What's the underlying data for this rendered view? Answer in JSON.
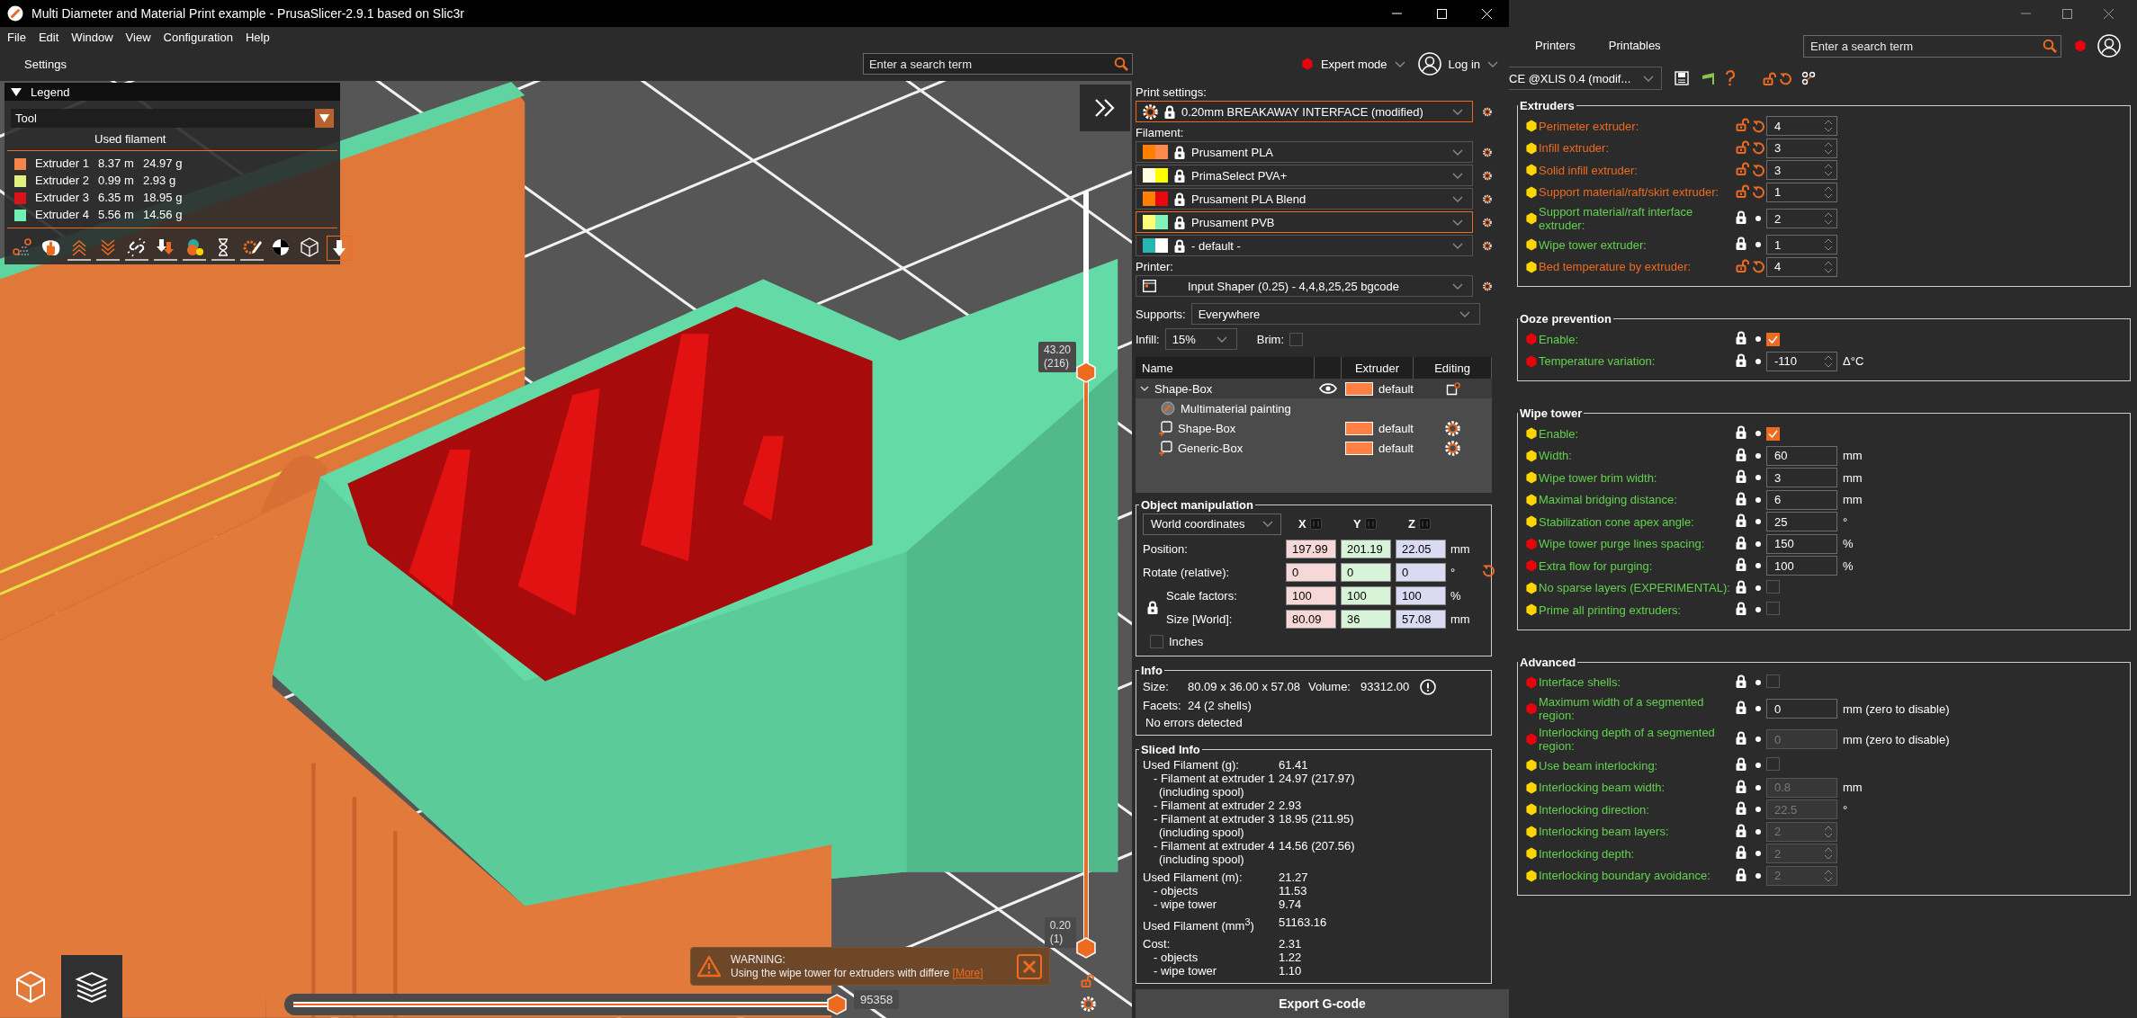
{
  "window": {
    "title": "Multi Diameter and Material Print example - PrusaSlicer-2.9.1 based on Slic3r"
  },
  "menu": [
    "File",
    "Edit",
    "Window",
    "View",
    "Configuration",
    "Help"
  ],
  "toolbar": {
    "settings": "Settings",
    "search": {
      "placeholder": "Enter a search term"
    },
    "mode": "Expert mode",
    "login": "Log in"
  },
  "legend": {
    "title": "Legend",
    "expanded": true,
    "view_type": "Tool",
    "header": "Used filament",
    "items": [
      {
        "name": "Extruder 1",
        "length": "8.37 m",
        "weight": "24.97 g",
        "color": "#f5854a"
      },
      {
        "name": "Extruder 2",
        "length": "0.99 m",
        "weight": "2.93 g",
        "color": "#e4f07e"
      },
      {
        "name": "Extruder 3",
        "length": "6.35 m",
        "weight": "18.95 g",
        "color": "#d8131c"
      },
      {
        "name": "Extruder 4",
        "length": "5.56 m",
        "weight": "14.56 g",
        "color": "#6ff0b4"
      }
    ],
    "options": [
      {
        "kind": "travel",
        "on": false
      },
      {
        "kind": "wipe",
        "on": false
      },
      {
        "kind": "retract",
        "on": true
      },
      {
        "kind": "deretract",
        "on": true
      },
      {
        "kind": "seams",
        "on": true
      },
      {
        "kind": "toolchange",
        "on": true
      },
      {
        "kind": "color_change",
        "on": true
      },
      {
        "kind": "pause",
        "on": true
      },
      {
        "kind": "custom_gcode",
        "on": true
      },
      {
        "kind": "center_of_gravity",
        "on": false
      },
      {
        "kind": "shells",
        "on": false
      },
      {
        "kind": "tool_marker",
        "on": true
      }
    ]
  },
  "viewport": {
    "vertical_slider": {
      "upper_thumb": {
        "value": "43.20",
        "layer": "(216)",
        "level": 0.76
      },
      "lower_thumb": {
        "value": "0.20",
        "layer": "(1)",
        "level": 0
      }
    },
    "horizontal_slider": {
      "value": "95358",
      "level": 1
    },
    "warning": {
      "title": "WARNING:",
      "text": "Using the wipe tower for extruders with differe",
      "link": "[More]"
    },
    "view_modes": [
      {
        "kind": "model",
        "selected": false
      },
      {
        "kind": "preview",
        "selected": true
      }
    ]
  },
  "sidebar": {
    "print_settings": {
      "label": "Print settings:",
      "preset": "0.20mm BREAKAWAY INTERFACE (modified)",
      "highlighted": true
    },
    "filament": {
      "label": "Filament:",
      "items": [
        {
          "name": "Prusament PLA",
          "swatches": [
            {
              "color": "#ff8000"
            },
            {
              "color": "#ff8a4c"
            }
          ],
          "highlighted": false
        },
        {
          "name": "PrimaSelect PVA+",
          "swatches": [
            {
              "color": "#fffde2"
            },
            {
              "color": "#ffff00"
            }
          ],
          "highlighted": false
        },
        {
          "name": "Prusament PLA Blend",
          "swatches": [
            {
              "color": "#ff8000"
            },
            {
              "color": "#e8070c"
            }
          ],
          "highlighted": false
        },
        {
          "name": "Prusament PVB",
          "swatches": [
            {
              "color": "#fcfc76"
            },
            {
              "color": "#82f2b6"
            }
          ],
          "highlighted": true
        },
        {
          "name": "- default -",
          "swatches": [
            {
              "color": "#26b5b0"
            },
            {
              "color": "#ffffff"
            }
          ],
          "highlighted": false
        }
      ]
    },
    "printer": {
      "label": "Printer:",
      "preset": "Input Shaper (0.25) - 4,4,8,25,25 bgcode"
    },
    "supports": {
      "label": "Supports:",
      "value": "Everywhere"
    },
    "infill": {
      "label": "Infill:",
      "value": "15%"
    },
    "brim": {
      "label": "Brim:",
      "checked": false
    },
    "object_list": {
      "columns": [
        "Name",
        "Extruder",
        "Editing"
      ],
      "rows": [
        {
          "kind": "object",
          "name": "Shape-Box",
          "expanded": true,
          "visible": true,
          "extruder": "default",
          "color": "#ff7f45",
          "children": [
            {
              "kind": "painting",
              "name": "Multimaterial painting"
            },
            {
              "kind": "part",
              "name": "Shape-Box",
              "extruder": "default",
              "color": "#ff7f45"
            },
            {
              "kind": "part",
              "name": "Generic-Box",
              "extruder": "default",
              "color": "#ff7f45"
            }
          ]
        }
      ]
    },
    "object_manipulation": {
      "title": "Object manipulation",
      "coordinates": "World coordinates",
      "axes": [
        "X",
        "Y",
        "Z"
      ],
      "rows": [
        {
          "kind": "position",
          "label": "Position:",
          "values": [
            "197.99",
            "201.19",
            "22.05"
          ],
          "unit": "mm"
        },
        {
          "kind": "rotate",
          "label": "Rotate (relative):",
          "values": [
            "0",
            "0",
            "0"
          ],
          "unit": "°"
        },
        {
          "kind": "scale",
          "label": "Scale factors:",
          "values": [
            "100",
            "100",
            "100"
          ],
          "unit": "%"
        },
        {
          "kind": "size",
          "label": "Size [World]:",
          "values": [
            "80.09",
            "36",
            "57.08"
          ],
          "unit": "mm"
        }
      ],
      "inches": {
        "label": "Inches",
        "checked": false
      }
    },
    "info": {
      "title": "Info",
      "size_label": "Size:",
      "size": "80.09 x 36.00 x 57.08",
      "volume_label": "Volume:",
      "volume": "93312.00",
      "facets_label": "Facets:",
      "facets": "24 (2 shells)",
      "status": "No errors detected"
    },
    "sliced_info": {
      "title": "Sliced Info",
      "groups": [
        {
          "label": "Used Filament (g):",
          "value": "61.41",
          "children": [
            {
              "label": "- Filament at extruder 1",
              "note": "(including spool)",
              "value": "24.97 (217.97)"
            },
            {
              "label": "- Filament at extruder 2",
              "value": "2.93"
            },
            {
              "label": "- Filament at extruder 3",
              "note": "(including spool)",
              "value": "18.95 (211.95)"
            },
            {
              "label": "- Filament at extruder 4",
              "note": "(including spool)",
              "value": "14.56 (207.56)"
            }
          ]
        },
        {
          "label": "Used Filament (m):",
          "value": "21.27",
          "children": [
            {
              "label": "- objects",
              "value": "11.53"
            },
            {
              "label": "- wipe tower",
              "value": "9.74"
            }
          ]
        },
        {
          "label": "Used Filament (mm$^{3}$)",
          "value": "51163.16"
        },
        {
          "label": "Cost:",
          "value": "2.31",
          "children": [
            {
              "label": "- objects",
              "value": "1.22"
            },
            {
              "label": "- wipe tower",
              "value": "1.10"
            }
          ]
        }
      ]
    },
    "export": "Export G-code"
  },
  "settings_window": {
    "tabs": [
      {
        "label": "Printers",
        "selected": false
      },
      {
        "label": "Printables",
        "selected": false
      }
    ],
    "search": {
      "placeholder": "Enter a search term"
    },
    "preset": "CE @XLIS 0.4 (modif...",
    "groups": [
      {
        "title": "Extruders",
        "options": [
          {
            "label": "Perimeter extruder:",
            "color": "#ffd600",
            "modified": true,
            "kind": "spin",
            "value": "4",
            "disabled": false
          },
          {
            "label": "Infill extruder:",
            "color": "#ffd600",
            "modified": true,
            "kind": "spin",
            "value": "3",
            "disabled": false
          },
          {
            "label": "Solid infill extruder:",
            "color": "#ffd600",
            "modified": true,
            "kind": "spin",
            "value": "3",
            "disabled": false
          },
          {
            "label": "Support material/raft/skirt extruder:",
            "color": "#ffd600",
            "modified": true,
            "kind": "spin",
            "value": "1",
            "disabled": false
          },
          {
            "label": "Support material/raft interface extruder:",
            "color": "#ffd600",
            "modified": false,
            "kind": "spin",
            "value": "2",
            "disabled": false
          },
          {
            "label": "Wipe tower extruder:",
            "color": "#ffd600",
            "modified": false,
            "kind": "spin",
            "value": "1",
            "disabled": false
          },
          {
            "label": "Bed temperature by extruder:",
            "color": "#ffd600",
            "modified": true,
            "kind": "spin",
            "value": "4",
            "disabled": false
          }
        ]
      },
      {
        "title": "Ooze prevention",
        "options": [
          {
            "label": "Enable:",
            "color": "#e8040b",
            "modified": false,
            "kind": "checkbox",
            "checked": true
          },
          {
            "label": "Temperature variation:",
            "color": "#e8040b",
            "modified": false,
            "kind": "spin",
            "value": "-110",
            "unit": "Δ°C",
            "disabled": false
          }
        ]
      },
      {
        "title": "Wipe tower",
        "options": [
          {
            "label": "Enable:",
            "color": "#ffd600",
            "modified": false,
            "kind": "checkbox",
            "checked": true
          },
          {
            "label": "Width:",
            "color": "#ffd600",
            "modified": false,
            "kind": "text",
            "value": "60",
            "unit": "mm",
            "disabled": false
          },
          {
            "label": "Wipe tower brim width:",
            "color": "#ffd600",
            "modified": false,
            "kind": "text",
            "value": "3",
            "unit": "mm",
            "disabled": false
          },
          {
            "label": "Maximal bridging distance:",
            "color": "#ffd600",
            "modified": false,
            "kind": "text",
            "value": "6",
            "unit": "mm",
            "disabled": false
          },
          {
            "label": "Stabilization cone apex angle:",
            "color": "#ffd600",
            "modified": false,
            "kind": "text",
            "value": "25",
            "unit": "°",
            "disabled": false
          },
          {
            "label": "Wipe tower purge lines spacing:",
            "color": "#e8040b",
            "modified": false,
            "kind": "text",
            "value": "150",
            "unit": "%",
            "disabled": false
          },
          {
            "label": "Extra flow for purging:",
            "color": "#e8040b",
            "modified": false,
            "kind": "text",
            "value": "100",
            "unit": "%",
            "disabled": false
          },
          {
            "label": "No sparse layers (EXPERIMENTAL):",
            "color": "#ffd600",
            "modified": false,
            "kind": "checkbox",
            "checked": false
          },
          {
            "label": "Prime all printing extruders:",
            "color": "#ffd600",
            "modified": false,
            "kind": "checkbox",
            "checked": false
          }
        ]
      },
      {
        "title": "Advanced",
        "options": [
          {
            "label": "Interface shells:",
            "color": "#e8040b",
            "modified": false,
            "kind": "checkbox",
            "checked": false
          },
          {
            "label": "Maximum width of a segmented region:",
            "color": "#e8040b",
            "modified": false,
            "kind": "text",
            "value": "0",
            "unit": "mm (zero to disable)",
            "disabled": false
          },
          {
            "label": "Interlocking depth of a segmented region:",
            "color": "#e8040b",
            "modified": false,
            "kind": "text",
            "value": "0",
            "unit": "mm (zero to disable)",
            "disabled": true
          },
          {
            "label": "Use beam interlocking:",
            "color": "#ffd600",
            "modified": false,
            "kind": "checkbox",
            "checked": false
          },
          {
            "label": "Interlocking beam width:",
            "color": "#ffd600",
            "modified": false,
            "kind": "text",
            "value": "0.8",
            "unit": "mm",
            "disabled": true
          },
          {
            "label": "Interlocking direction:",
            "color": "#ffd600",
            "modified": false,
            "kind": "text",
            "value": "22.5",
            "unit": "°",
            "disabled": true
          },
          {
            "label": "Interlocking beam layers:",
            "color": "#ffd600",
            "modified": false,
            "kind": "spin",
            "value": "2",
            "disabled": true
          },
          {
            "label": "Interlocking depth:",
            "color": "#ffd600",
            "modified": false,
            "kind": "spin",
            "value": "2",
            "disabled": true
          },
          {
            "label": "Interlocking boundary avoidance:",
            "color": "#ffd600",
            "modified": false,
            "kind": "spin",
            "value": "2",
            "disabled": true
          }
        ]
      }
    ]
  }
}
